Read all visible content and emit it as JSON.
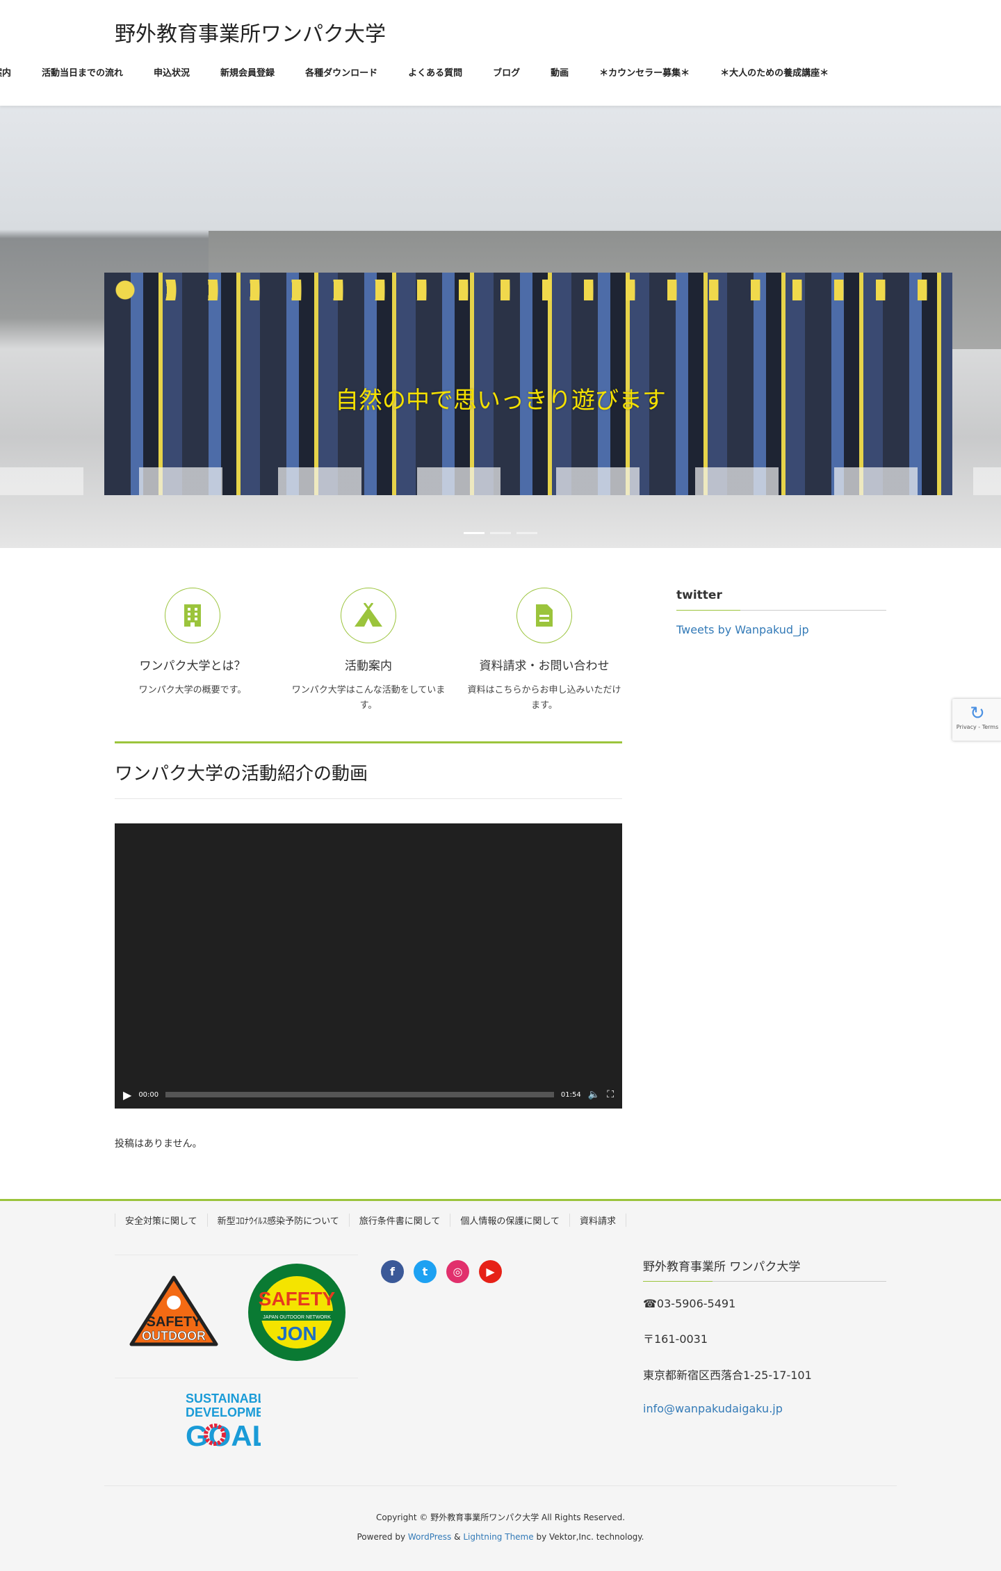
{
  "header": {
    "site_title": "野外教育事業所ワンパク大学",
    "nav": [
      "案内",
      "活動当日までの流れ",
      "申込状況",
      "新規会員登録",
      "各種ダウンロード",
      "よくある質問",
      "ブログ",
      "動画",
      "＊カウンセラー募集＊",
      "＊大人のための養成講座＊"
    ]
  },
  "hero": {
    "caption": "自然の中で思いっきり遊びます",
    "slide_count": 3,
    "active_slide": 1
  },
  "pr_blocks": [
    {
      "icon": "building-icon",
      "title": "ワンパク大学とは？",
      "text": "ワンパク大学の概要です。"
    },
    {
      "icon": "tent-icon",
      "title": "活動案内",
      "text": "ワンパク大学はこんな活動をしています。"
    },
    {
      "icon": "document-icon",
      "title": "資料請求・お問い合わせ",
      "text": "資料はこちらからお申し込みいただけます。"
    }
  ],
  "main": {
    "section_title": "ワンパク大学の活動紹介の動画",
    "video": {
      "current_time": "00:00",
      "duration": "01:54",
      "progress": 0
    },
    "no_posts": "投稿はありません。"
  },
  "sidebar": {
    "heading": "twitter",
    "link": "Tweets by Wanpakud_jp"
  },
  "recaptcha": {
    "label": "Privacy - Terms"
  },
  "footer": {
    "nav": [
      "安全対策に関して",
      "新型ｺﾛﾅｳｲﾙｽ感染予防について",
      "旅行条件書に関して",
      "個人情報の保護に関して",
      "資料請求"
    ],
    "logos": {
      "safety_outdoor": "SAFETY OUTDOOR",
      "jon": "SAFETY JAPAN OUTDOOR NETWORK JON",
      "sdgs": [
        "SUSTAINABLE",
        "DEVELOPMENT",
        "GOALS"
      ]
    },
    "social": [
      "facebook-icon",
      "twitter-icon",
      "instagram-icon",
      "youtube-icon"
    ],
    "contact": {
      "name": "野外教育事業所 ワンパク大学",
      "phone": "☎03-5906-5491",
      "zip": "〒161-0031",
      "address": "東京都新宿区西落合1-25-17-101",
      "email": "info@wanpakudaigaku.jp"
    },
    "copyright": "Copyright © 野外教育事業所ワンパク大学 All Rights Reserved.",
    "powered": {
      "prefix": "Powered by ",
      "wordpress": "WordPress",
      "amp": " & ",
      "theme": "Lightning Theme",
      "suffix": " by Vektor,Inc. technology."
    }
  },
  "colors": {
    "accent": "#9bc43c",
    "link": "#337ab7",
    "caption": "#f4e000"
  }
}
